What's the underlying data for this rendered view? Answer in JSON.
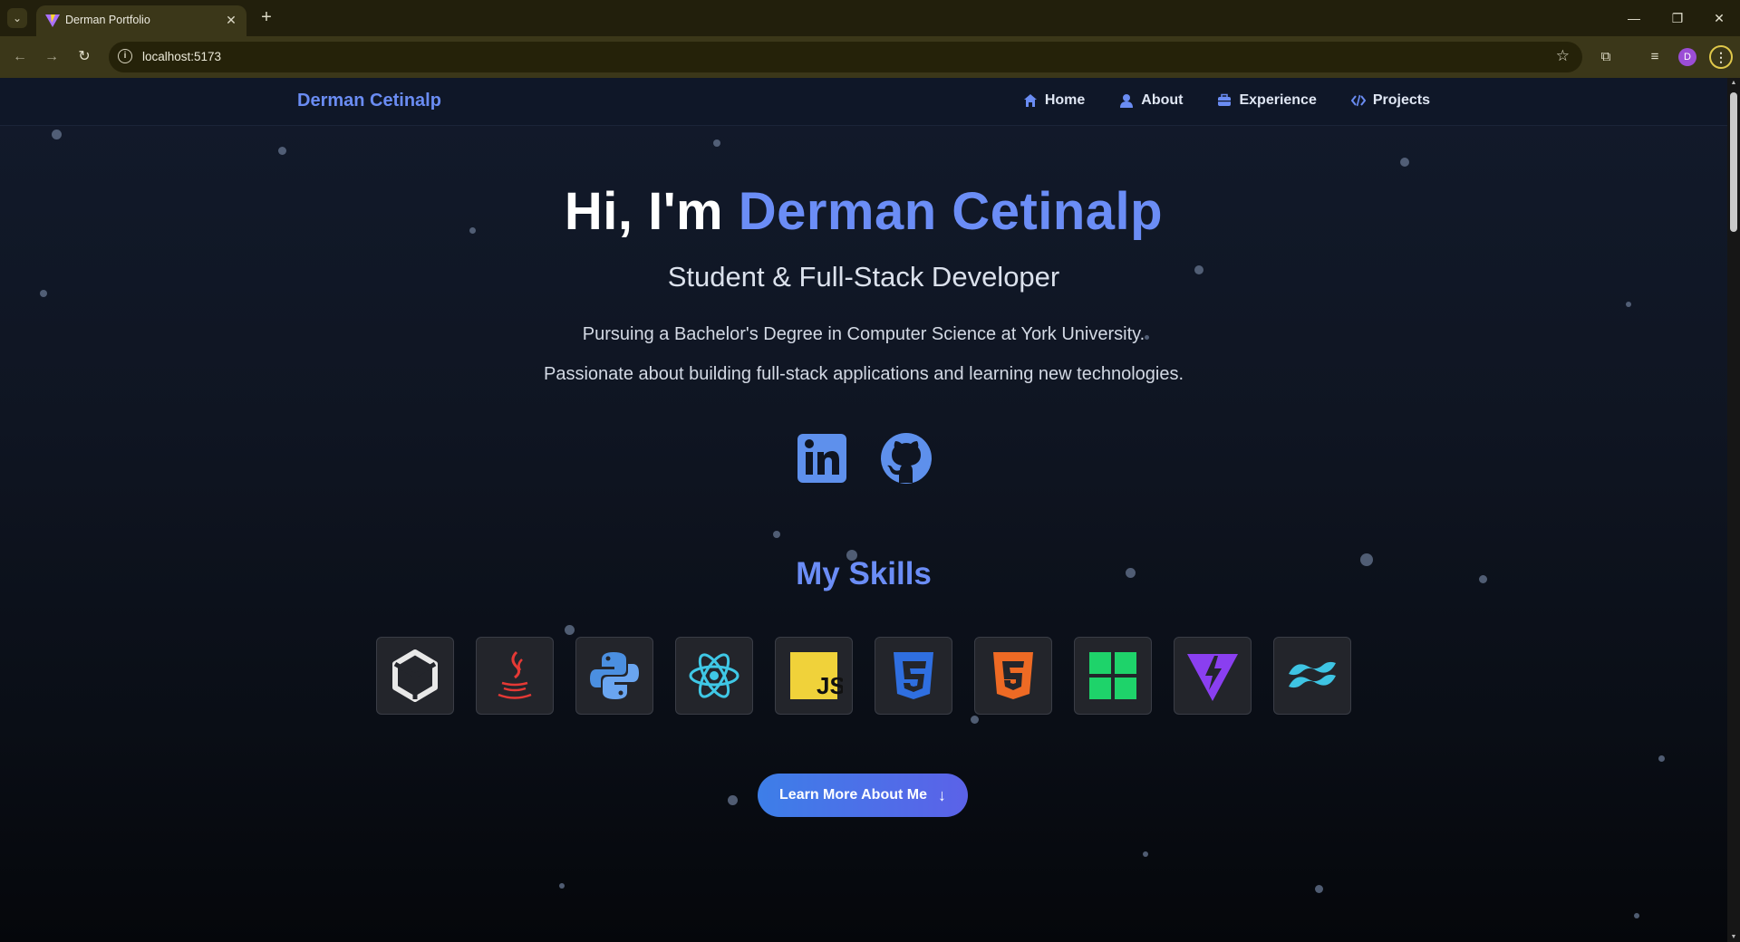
{
  "browser": {
    "tab_title": "Derman Portfolio",
    "url": "localhost:5173",
    "profile_initial": "D"
  },
  "site": {
    "brand": "Derman Cetinalp",
    "nav": [
      {
        "label": "Home",
        "icon": "home-icon"
      },
      {
        "label": "About",
        "icon": "user-icon"
      },
      {
        "label": "Experience",
        "icon": "briefcase-icon"
      },
      {
        "label": "Projects",
        "icon": "code-icon"
      }
    ]
  },
  "hero": {
    "greeting": "Hi, I'm",
    "name": "Derman Cetinalp",
    "subtitle": "Student & Full-Stack Developer",
    "line1": "Pursuing a Bachelor's Degree in Computer Science at York University.",
    "line2": "Passionate about building full-stack applications and learning new technologies."
  },
  "socials": [
    {
      "name": "linkedin-icon",
      "color": "#5e90ec"
    },
    {
      "name": "github-icon",
      "color": "#5e90ec"
    }
  ],
  "skills": {
    "title": "My Skills",
    "icons": [
      "unity-icon",
      "java-icon",
      "python-icon",
      "react-icon",
      "javascript-icon",
      "css3-icon",
      "html5-icon",
      "windows-icon",
      "vite-icon",
      "tailwind-icon"
    ],
    "js_text": "JS"
  },
  "cta": {
    "label": "Learn More About Me"
  },
  "colors": {
    "accent": "#6b8df6",
    "background": "#0f1522",
    "button": "#4a72e8"
  }
}
